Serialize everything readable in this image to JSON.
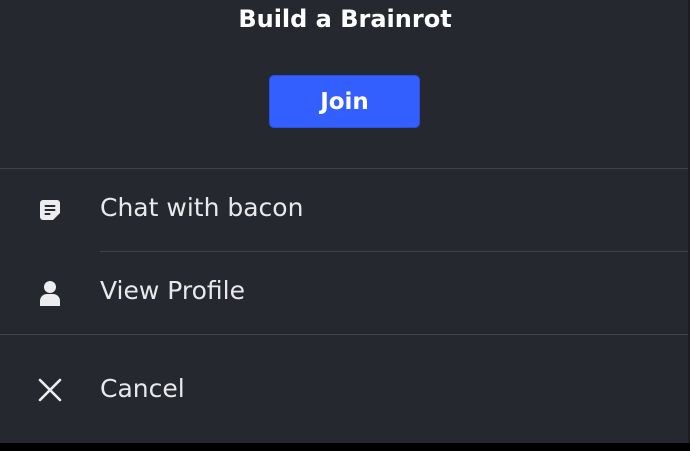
{
  "header": {
    "title": "Build a Brainrot",
    "join_label": "Join"
  },
  "menu": {
    "items": [
      {
        "label": "Chat with bacon",
        "icon": "chat-icon"
      },
      {
        "label": "View Profile",
        "icon": "profile-icon"
      },
      {
        "label": "Cancel",
        "icon": "close-icon"
      }
    ]
  },
  "colors": {
    "background": "#262830",
    "accent": "#335fff",
    "divider": "#41444d",
    "text": "#e9e9eb"
  }
}
